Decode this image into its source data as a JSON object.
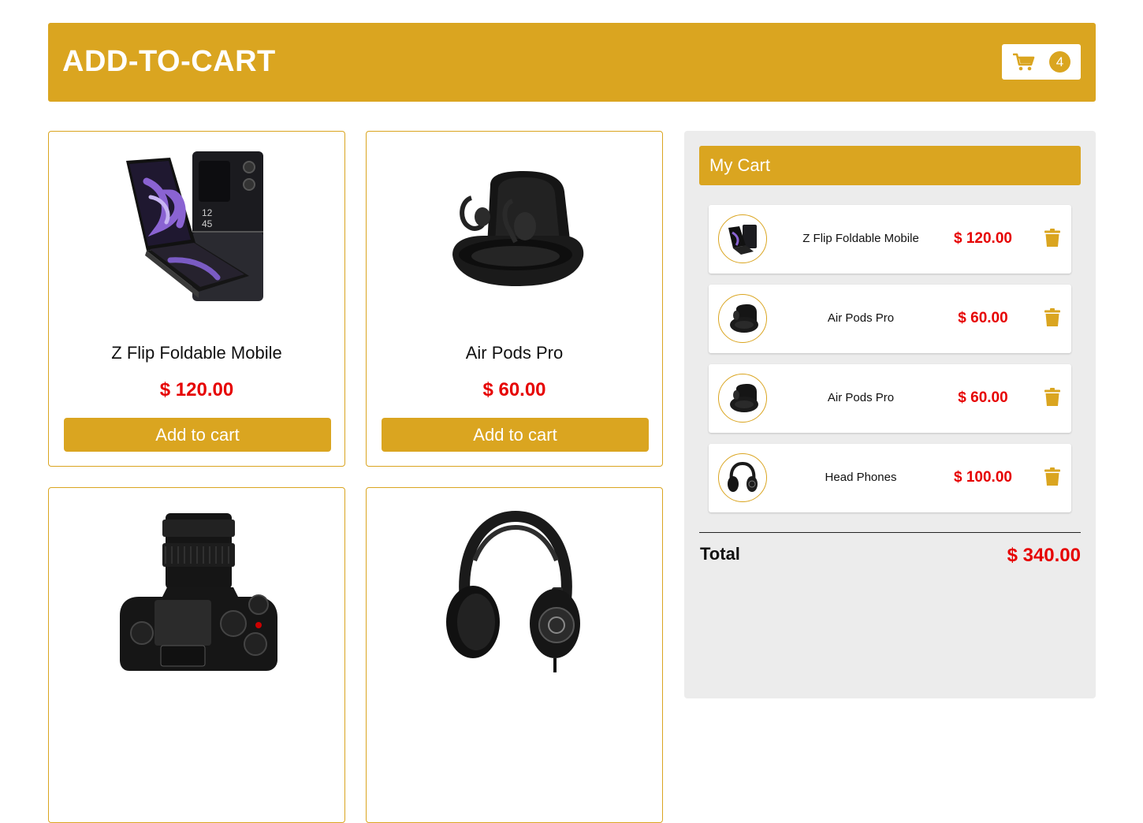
{
  "header": {
    "title": "ADD-TO-CART",
    "cart_count": "4"
  },
  "products": [
    {
      "name": "Z Flip Foldable Mobile",
      "price": "$ 120.00",
      "button": "Add to cart",
      "image": "foldable-phone"
    },
    {
      "name": "Air Pods Pro",
      "price": "$ 60.00",
      "button": "Add to cart",
      "image": "earbuds-case"
    },
    {
      "name": "",
      "price": "",
      "button": "",
      "image": "camera"
    },
    {
      "name": "",
      "price": "",
      "button": "",
      "image": "headphones"
    }
  ],
  "cart": {
    "title": "My Cart",
    "items": [
      {
        "name": "Z Flip Foldable Mobile",
        "price": "$ 120.00",
        "image": "foldable-phone"
      },
      {
        "name": "Air Pods Pro",
        "price": "$ 60.00",
        "image": "earbuds-case"
      },
      {
        "name": "Air Pods Pro",
        "price": "$ 60.00",
        "image": "earbuds-case"
      },
      {
        "name": "Head Phones",
        "price": "$ 100.00",
        "image": "headphones"
      }
    ],
    "total_label": "Total",
    "total_value": "$ 340.00"
  },
  "colors": {
    "accent": "#daa520",
    "price": "#e60000",
    "panel": "#ececec"
  },
  "icons": {
    "cart": "shopping-cart-icon",
    "delete": "trash-icon"
  }
}
